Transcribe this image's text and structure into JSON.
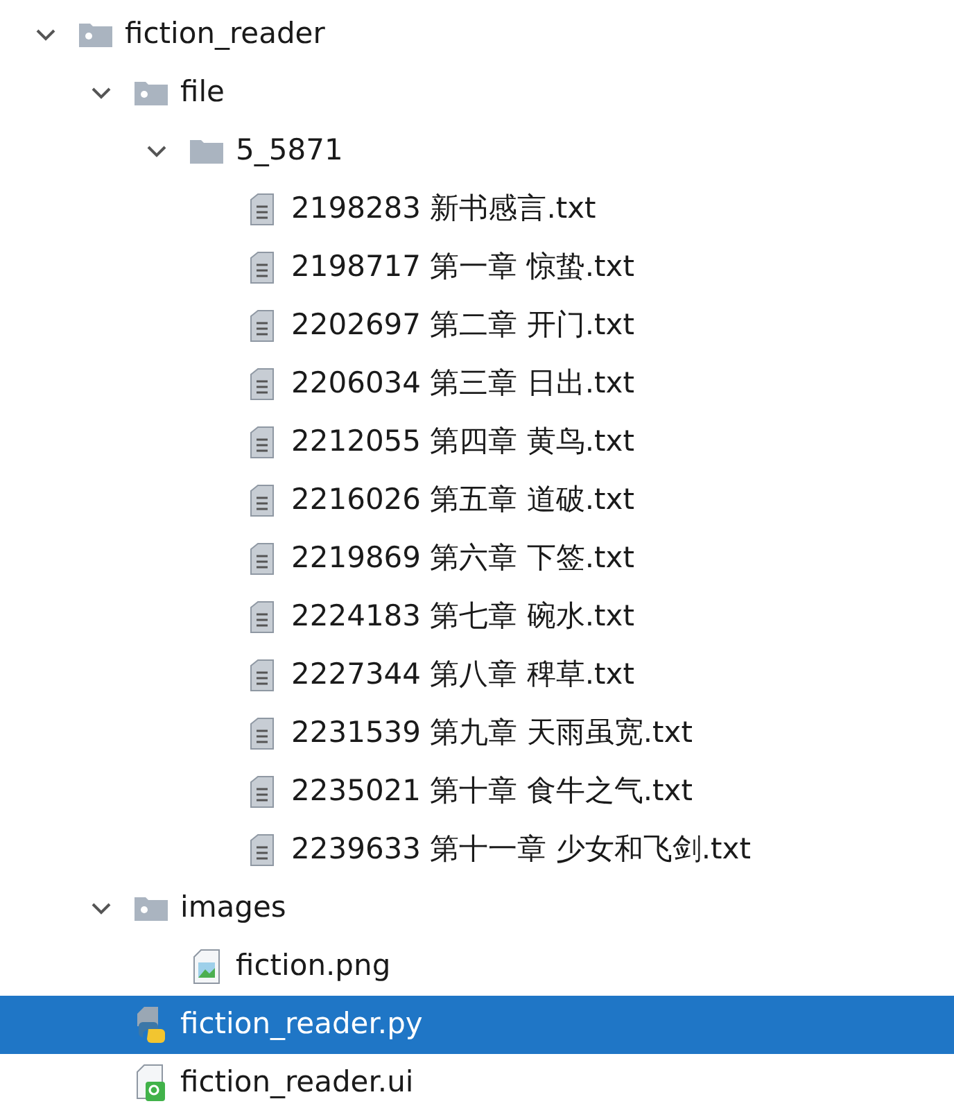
{
  "project_tree": [
    {
      "name": "fiction_reader",
      "kind": "folder",
      "expanded": true,
      "selected": false,
      "children": [
        {
          "name": "file",
          "kind": "folder",
          "expanded": true,
          "selected": false,
          "children": [
            {
              "name": "5_5871",
              "kind": "folder",
              "expanded": true,
              "selected": false,
              "children": [
                {
                  "name": "2198283 新书感言.txt",
                  "kind": "text",
                  "selected": false
                },
                {
                  "name": "2198717 第一章 惊蛰.txt",
                  "kind": "text",
                  "selected": false
                },
                {
                  "name": "2202697 第二章 开门.txt",
                  "kind": "text",
                  "selected": false
                },
                {
                  "name": "2206034 第三章 日出.txt",
                  "kind": "text",
                  "selected": false
                },
                {
                  "name": "2212055 第四章 黄鸟.txt",
                  "kind": "text",
                  "selected": false
                },
                {
                  "name": "2216026 第五章 道破.txt",
                  "kind": "text",
                  "selected": false
                },
                {
                  "name": "2219869 第六章 下签.txt",
                  "kind": "text",
                  "selected": false
                },
                {
                  "name": "2224183 第七章 碗水.txt",
                  "kind": "text",
                  "selected": false
                },
                {
                  "name": "2227344 第八章 稗草.txt",
                  "kind": "text",
                  "selected": false
                },
                {
                  "name": "2231539 第九章 天雨虽宽.txt",
                  "kind": "text",
                  "selected": false
                },
                {
                  "name": "2235021 第十章 食牛之气.txt",
                  "kind": "text",
                  "selected": false
                },
                {
                  "name": "2239633 第十一章 少女和飞剑.txt",
                  "kind": "text",
                  "selected": false
                }
              ]
            }
          ]
        },
        {
          "name": "images",
          "kind": "folder",
          "expanded": true,
          "selected": false,
          "children": [
            {
              "name": "fiction.png",
              "kind": "image",
              "selected": false
            }
          ]
        },
        {
          "name": "fiction_reader.py",
          "kind": "python",
          "selected": true
        },
        {
          "name": "fiction_reader.ui",
          "kind": "qt",
          "selected": false
        }
      ]
    }
  ]
}
